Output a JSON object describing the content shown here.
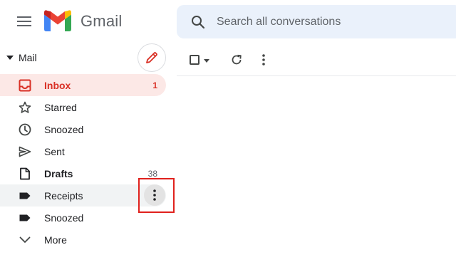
{
  "app": {
    "name": "Gmail"
  },
  "search": {
    "placeholder": "Search all conversations"
  },
  "sidebar": {
    "section_title": "Mail",
    "items": [
      {
        "label": "Inbox",
        "count": "1",
        "icon": "inbox-icon",
        "active": true
      },
      {
        "label": "Starred",
        "count": "",
        "icon": "star-icon"
      },
      {
        "label": "Snoozed",
        "count": "",
        "icon": "clock-icon"
      },
      {
        "label": "Sent",
        "count": "",
        "icon": "send-icon"
      },
      {
        "label": "Drafts",
        "count": "38",
        "icon": "draft-icon"
      },
      {
        "label": "Receipts",
        "count": "",
        "icon": "label-icon",
        "hovered": true
      },
      {
        "label": "Snoozed",
        "count": "",
        "icon": "label-icon"
      },
      {
        "label": "More",
        "count": "",
        "icon": "chevron-down-icon"
      }
    ]
  },
  "colors": {
    "accent_red": "#d93025",
    "active_bg": "#fce8e6",
    "search_bg": "#eaf1fb",
    "highlight_box": "#e0211d"
  }
}
